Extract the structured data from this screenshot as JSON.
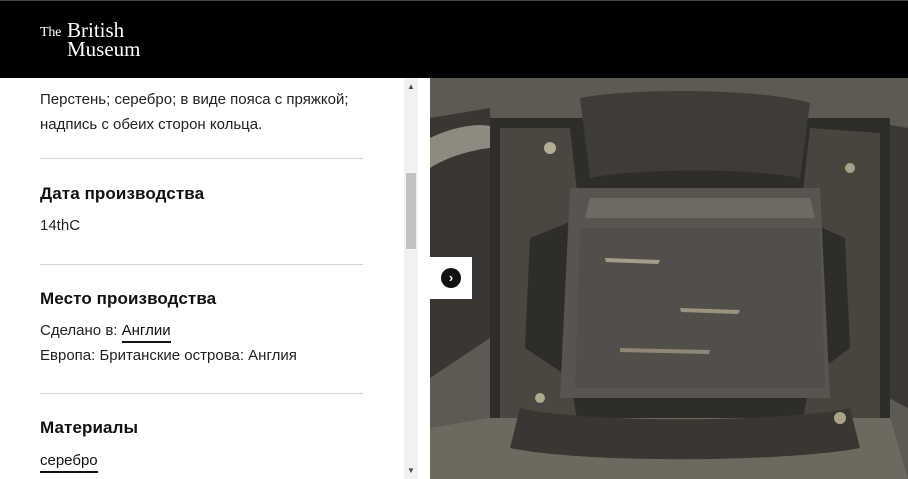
{
  "header": {
    "logo_the": "The",
    "logo_british": "British",
    "logo_museum": "Museum"
  },
  "object": {
    "description": "Перстень; серебро; в виде пояса с пряжкой; надпись с обеих сторон кольца.",
    "production_date": {
      "title": "Дата производства",
      "value": "14thC"
    },
    "production_place": {
      "title": "Место производства",
      "made_in_label": "Сделано в:",
      "made_in_link": "Англии",
      "region": "Европа: Британские острова: Англия"
    },
    "materials": {
      "title": "Материалы",
      "value": "серебро"
    }
  },
  "icons": {
    "scroll_up": "scroll-up-arrow",
    "scroll_down": "scroll-down-arrow",
    "next": "chevron-right-icon"
  },
  "colors": {
    "header_bg": "#000000",
    "image_bg": "#55514a"
  }
}
